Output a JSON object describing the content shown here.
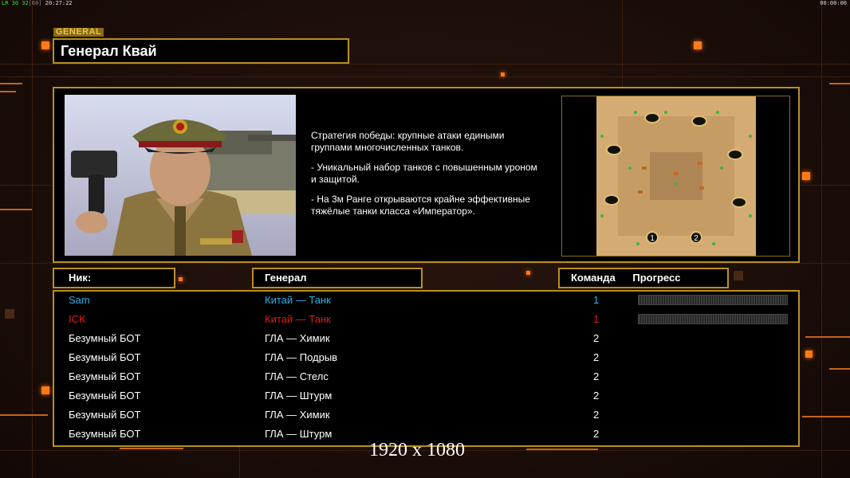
{
  "hud": {
    "left_stats": "LR 30 32",
    "left_bracket": "[60]",
    "left_time": "20:27:22",
    "right_time": "00:00:00"
  },
  "header": {
    "tab_label": "GENERAL",
    "general_name": "Генерал Квай"
  },
  "info": {
    "description": [
      "Стратегия победы: крупные атаки едиными\n группами многочисленных танков.",
      "- Уникальный набор танков с повышенным уроном\n и защитой.",
      "- На 3м Ранге открываются крайне эффективные\n тяжёлые танки класса «Император»."
    ],
    "map_slots": [
      "1",
      "2"
    ]
  },
  "table": {
    "headers": {
      "nick": "Ник:",
      "general": "Генерал",
      "team": "Команда",
      "progress": "Прогресс"
    },
    "rows": [
      {
        "nick": "Sam",
        "general": "Китай — Танк",
        "team": "1",
        "color": "#2ab0e8",
        "progress": true
      },
      {
        "nick": "ICK",
        "general": "Китай — Танк",
        "team": "1",
        "color": "#e81a1a",
        "progress": true
      },
      {
        "nick": "Безумный БОТ",
        "general": "ГЛА — Химик",
        "team": "2",
        "color": "#ffffff",
        "progress": false
      },
      {
        "nick": "Безумный БОТ",
        "general": "ГЛА — Подрыв",
        "team": "2",
        "color": "#ffffff",
        "progress": false
      },
      {
        "nick": "Безумный БОТ",
        "general": "ГЛА — Стелс",
        "team": "2",
        "color": "#ffffff",
        "progress": false
      },
      {
        "nick": "Безумный БОТ",
        "general": "ГЛА — Штурм",
        "team": "2",
        "color": "#ffffff",
        "progress": false
      },
      {
        "nick": "Безумный БОТ",
        "general": "ГЛА — Химик",
        "team": "2",
        "color": "#ffffff",
        "progress": false
      },
      {
        "nick": "Безумный БОТ",
        "general": "ГЛА — Штурм",
        "team": "2",
        "color": "#ffffff",
        "progress": false
      }
    ]
  },
  "resolution_label": "1920 x 1080"
}
